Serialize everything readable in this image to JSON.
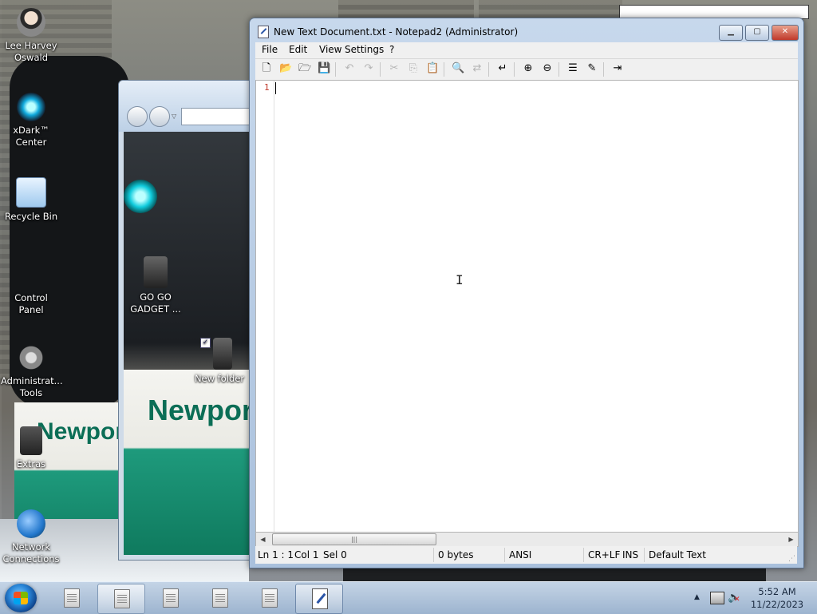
{
  "desktop": {
    "icons": [
      {
        "label": "Lee Harvey Oswald",
        "icon": "person-avatar-icon"
      },
      {
        "label": "xDark™ Center",
        "icon": "xdark-orb-icon"
      },
      {
        "label": "Recycle Bin",
        "icon": "recycle-bin-icon"
      },
      {
        "label": "Control Panel",
        "icon": "control-panel-icon"
      },
      {
        "label": "Administrat... Tools",
        "icon": "gear-tools-icon"
      },
      {
        "label": "Extras",
        "icon": "folder-icon"
      },
      {
        "label": "Network Connections",
        "icon": "network-globe-icon"
      }
    ],
    "explorer_items": [
      {
        "label": "GO GO GADGET ...",
        "icon": "drive-icon"
      },
      {
        "label": "New folder",
        "icon": "folder-icon"
      }
    ],
    "wallpaper_text": "Newport"
  },
  "notepad": {
    "title": "New Text Document.txt - Notepad2 (Administrator)",
    "caption_buttons": {
      "minimize": "▁",
      "maximize": "▢",
      "close": "✕"
    },
    "menus": [
      "File",
      "Edit",
      "View",
      "Settings",
      "?"
    ],
    "toolbar": [
      {
        "icon": "new-file-icon",
        "glyph": "🗋",
        "enabled": true
      },
      {
        "icon": "open-folder-icon",
        "glyph": "📂",
        "enabled": true
      },
      {
        "icon": "browse-icon",
        "glyph": "🗁",
        "enabled": true
      },
      {
        "icon": "save-icon",
        "glyph": "💾",
        "enabled": true
      },
      {
        "icon": "undo-icon",
        "glyph": "↶",
        "enabled": false
      },
      {
        "icon": "redo-icon",
        "glyph": "↷",
        "enabled": false
      },
      {
        "icon": "cut-icon",
        "glyph": "✂",
        "enabled": false
      },
      {
        "icon": "copy-icon",
        "glyph": "⎘",
        "enabled": false
      },
      {
        "icon": "paste-icon",
        "glyph": "📋",
        "enabled": false
      },
      {
        "icon": "find-icon",
        "glyph": "🔍",
        "enabled": false
      },
      {
        "icon": "replace-icon",
        "glyph": "⇄",
        "enabled": false
      },
      {
        "icon": "word-wrap-icon",
        "glyph": "↵",
        "enabled": true
      },
      {
        "icon": "zoom-in-icon",
        "glyph": "⊕",
        "enabled": true
      },
      {
        "icon": "zoom-out-icon",
        "glyph": "⊖",
        "enabled": true
      },
      {
        "icon": "scheme-icon",
        "glyph": "☰",
        "enabled": true
      },
      {
        "icon": "customize-icon",
        "glyph": "✎",
        "enabled": true
      },
      {
        "icon": "exit-icon",
        "glyph": "⇥",
        "enabled": true
      }
    ],
    "editor": {
      "line_number": "1",
      "content": ""
    },
    "status": {
      "position": "Ln 1 : 1",
      "column": "Col 1",
      "selection": "Sel 0",
      "size": "0 bytes",
      "encoding": "ANSI",
      "line_endings": "CR+LF",
      "mode": "INS",
      "scheme": "Default Text"
    }
  },
  "taskbar": {
    "buttons": [
      {
        "icon": "text-file-icon",
        "active": false
      },
      {
        "icon": "text-file-icon",
        "active": true
      },
      {
        "icon": "text-file-icon",
        "active": false
      },
      {
        "icon": "text-file-icon",
        "active": false
      },
      {
        "icon": "text-file-icon",
        "active": false
      },
      {
        "icon": "notepad2-icon",
        "active": true
      }
    ],
    "tray": {
      "show_hidden": "▲"
    },
    "clock": {
      "time": "5:52 AM",
      "date": "11/22/2023"
    }
  }
}
